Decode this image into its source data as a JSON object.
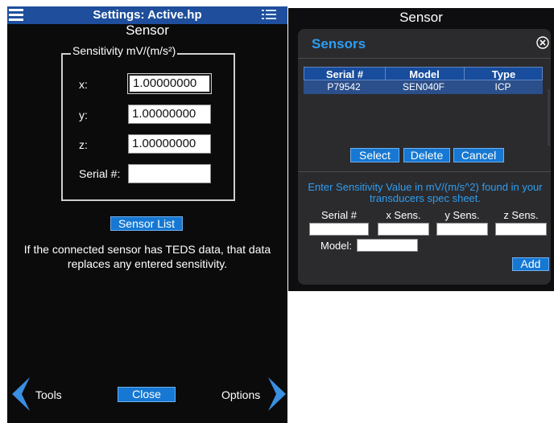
{
  "left": {
    "title": "Settings: Active.hp",
    "subtitle": "Sensor",
    "sensitivity_legend": "Sensitivity mV/(m/s²)",
    "x_label": "x:",
    "y_label": "y:",
    "z_label": "z:",
    "serial_label": "Serial #:",
    "x_value": "1.00000000",
    "y_value": "1.00000000",
    "z_value": "1.00000000",
    "serial_value": "",
    "sensor_list_button": "Sensor List",
    "info_text": "If the connected sensor has TEDS data, that data replaces any entered sensitivity.",
    "nav": {
      "back_label": "Tools",
      "close_label": "Close",
      "forward_label": "Options"
    }
  },
  "right": {
    "window_title": "Sensor",
    "dialog": {
      "heading": "Sensors",
      "table": {
        "columns": [
          "Serial #",
          "Model",
          "Type"
        ],
        "rows": [
          [
            "P79542",
            "SEN040F",
            "ICP"
          ]
        ]
      },
      "buttons": {
        "select": "Select",
        "delete": "Delete",
        "cancel": "Cancel"
      },
      "instruction": "Enter Sensitivity Value in mV/(m/s^2) found in your transducers spec sheet.",
      "entry_columns": [
        "Serial #",
        "x Sens.",
        "y Sens.",
        "z Sens."
      ],
      "model_label": "Model:",
      "add_button": "Add"
    }
  },
  "colors": {
    "title_bar": "#1f4f9c",
    "button_blue": "#1678d2",
    "accent_text": "#2e9ef2",
    "table_header": "#184c9c",
    "table_row": "#2b4f8a",
    "chevron": "#3a8fe0"
  },
  "icons": {
    "menu": "hamburger-icon",
    "list": "list-icon",
    "close": "circle-x-icon",
    "back": "chevron-left-icon",
    "forward": "chevron-right-icon"
  }
}
